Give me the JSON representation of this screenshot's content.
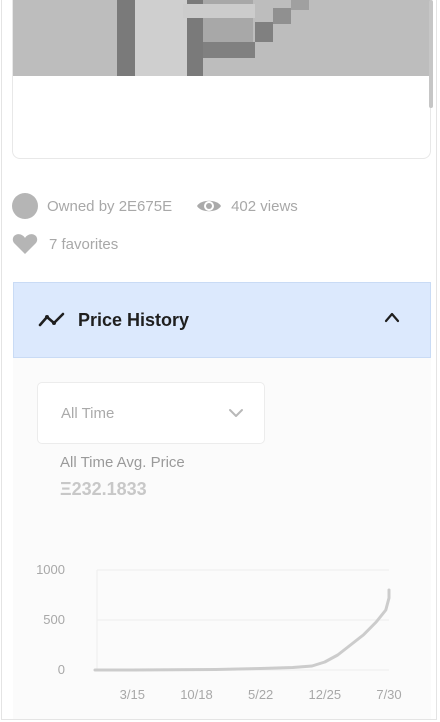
{
  "owner": {
    "label": "Owned by 2E675E"
  },
  "stats": {
    "views": "402 views",
    "favorites": "7 favorites"
  },
  "icons": {
    "avatar": "avatar-circle",
    "views": "eye-icon",
    "favorites": "heart-icon",
    "price_history": "trend-line-icon",
    "collapse": "chevron-up-icon",
    "dropdown": "chevron-down-icon"
  },
  "price_history": {
    "title": "Price History",
    "filter": {
      "selected": "All Time"
    },
    "avg_label": "All Time Avg. Price",
    "avg_value": "Ξ232.1833"
  },
  "colors": {
    "header_bg": "#dce9fd",
    "line": "#cccccc"
  },
  "chart_data": {
    "type": "line",
    "y_ticks": [
      "1000",
      "500",
      "0"
    ],
    "x_ticks": [
      "3/15",
      "10/18",
      "5/22",
      "12/25",
      "7/30"
    ],
    "ylim": [
      0,
      1000
    ],
    "grid": true,
    "series": [
      {
        "x": [
          0,
          1.3,
          2,
          2.5,
          2.8,
          3.0,
          3.2,
          3.4,
          3.6,
          3.8,
          3.95,
          4.0,
          4.0
        ],
        "values": [
          0,
          5,
          15,
          25,
          40,
          80,
          150,
          250,
          350,
          480,
          600,
          720,
          800
        ]
      }
    ]
  }
}
